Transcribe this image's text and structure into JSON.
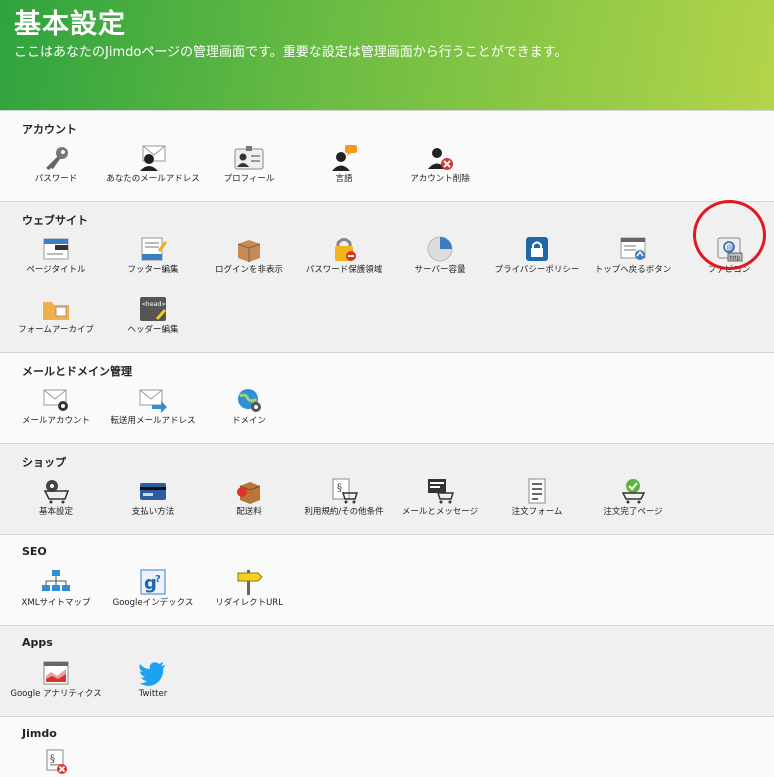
{
  "header": {
    "title": "基本設定",
    "subtitle": "ここはあなたのJimdoページの管理画面です。重要な設定は管理画面から行うことができます。"
  },
  "sections": {
    "account": {
      "title": "アカウント",
      "items": [
        "パスワード",
        "あなたのメールアドレス",
        "プロフィール",
        "言語",
        "アカウント削除"
      ]
    },
    "website": {
      "title": "ウェブサイト",
      "items": [
        "ページタイトル",
        "フッター編集",
        "ログインを非表示",
        "パスワード保護領域",
        "サーバー容量",
        "プライバシーポリシー",
        "トップへ戻るボタン",
        "ファビコン",
        "フォームアーカイブ",
        "ヘッダー編集"
      ]
    },
    "mail": {
      "title": "メールとドメイン管理",
      "items": [
        "メールアカウント",
        "転送用メールアドレス",
        "ドメイン"
      ]
    },
    "shop": {
      "title": "ショップ",
      "items": [
        "基本設定",
        "支払い方法",
        "配送料",
        "利用規約/その他条件",
        "メールとメッセージ",
        "注文フォーム",
        "注文完了ページ"
      ]
    },
    "seo": {
      "title": "SEO",
      "items": [
        "XMLサイトマップ",
        "Googleインデックス",
        "リダイレクトURL"
      ]
    },
    "apps": {
      "title": "Apps",
      "items": [
        "Google アナリティクス",
        "Twitter"
      ]
    },
    "jimdo": {
      "title": "Jimdo"
    }
  },
  "icons": {
    "head_tag": "<head>",
    "http_tag": "http"
  },
  "colors": {
    "header_start": "#2fa33f",
    "header_end": "#b4d44a",
    "highlight_circle": "#e3171c",
    "twitter": "#1da1f2"
  }
}
